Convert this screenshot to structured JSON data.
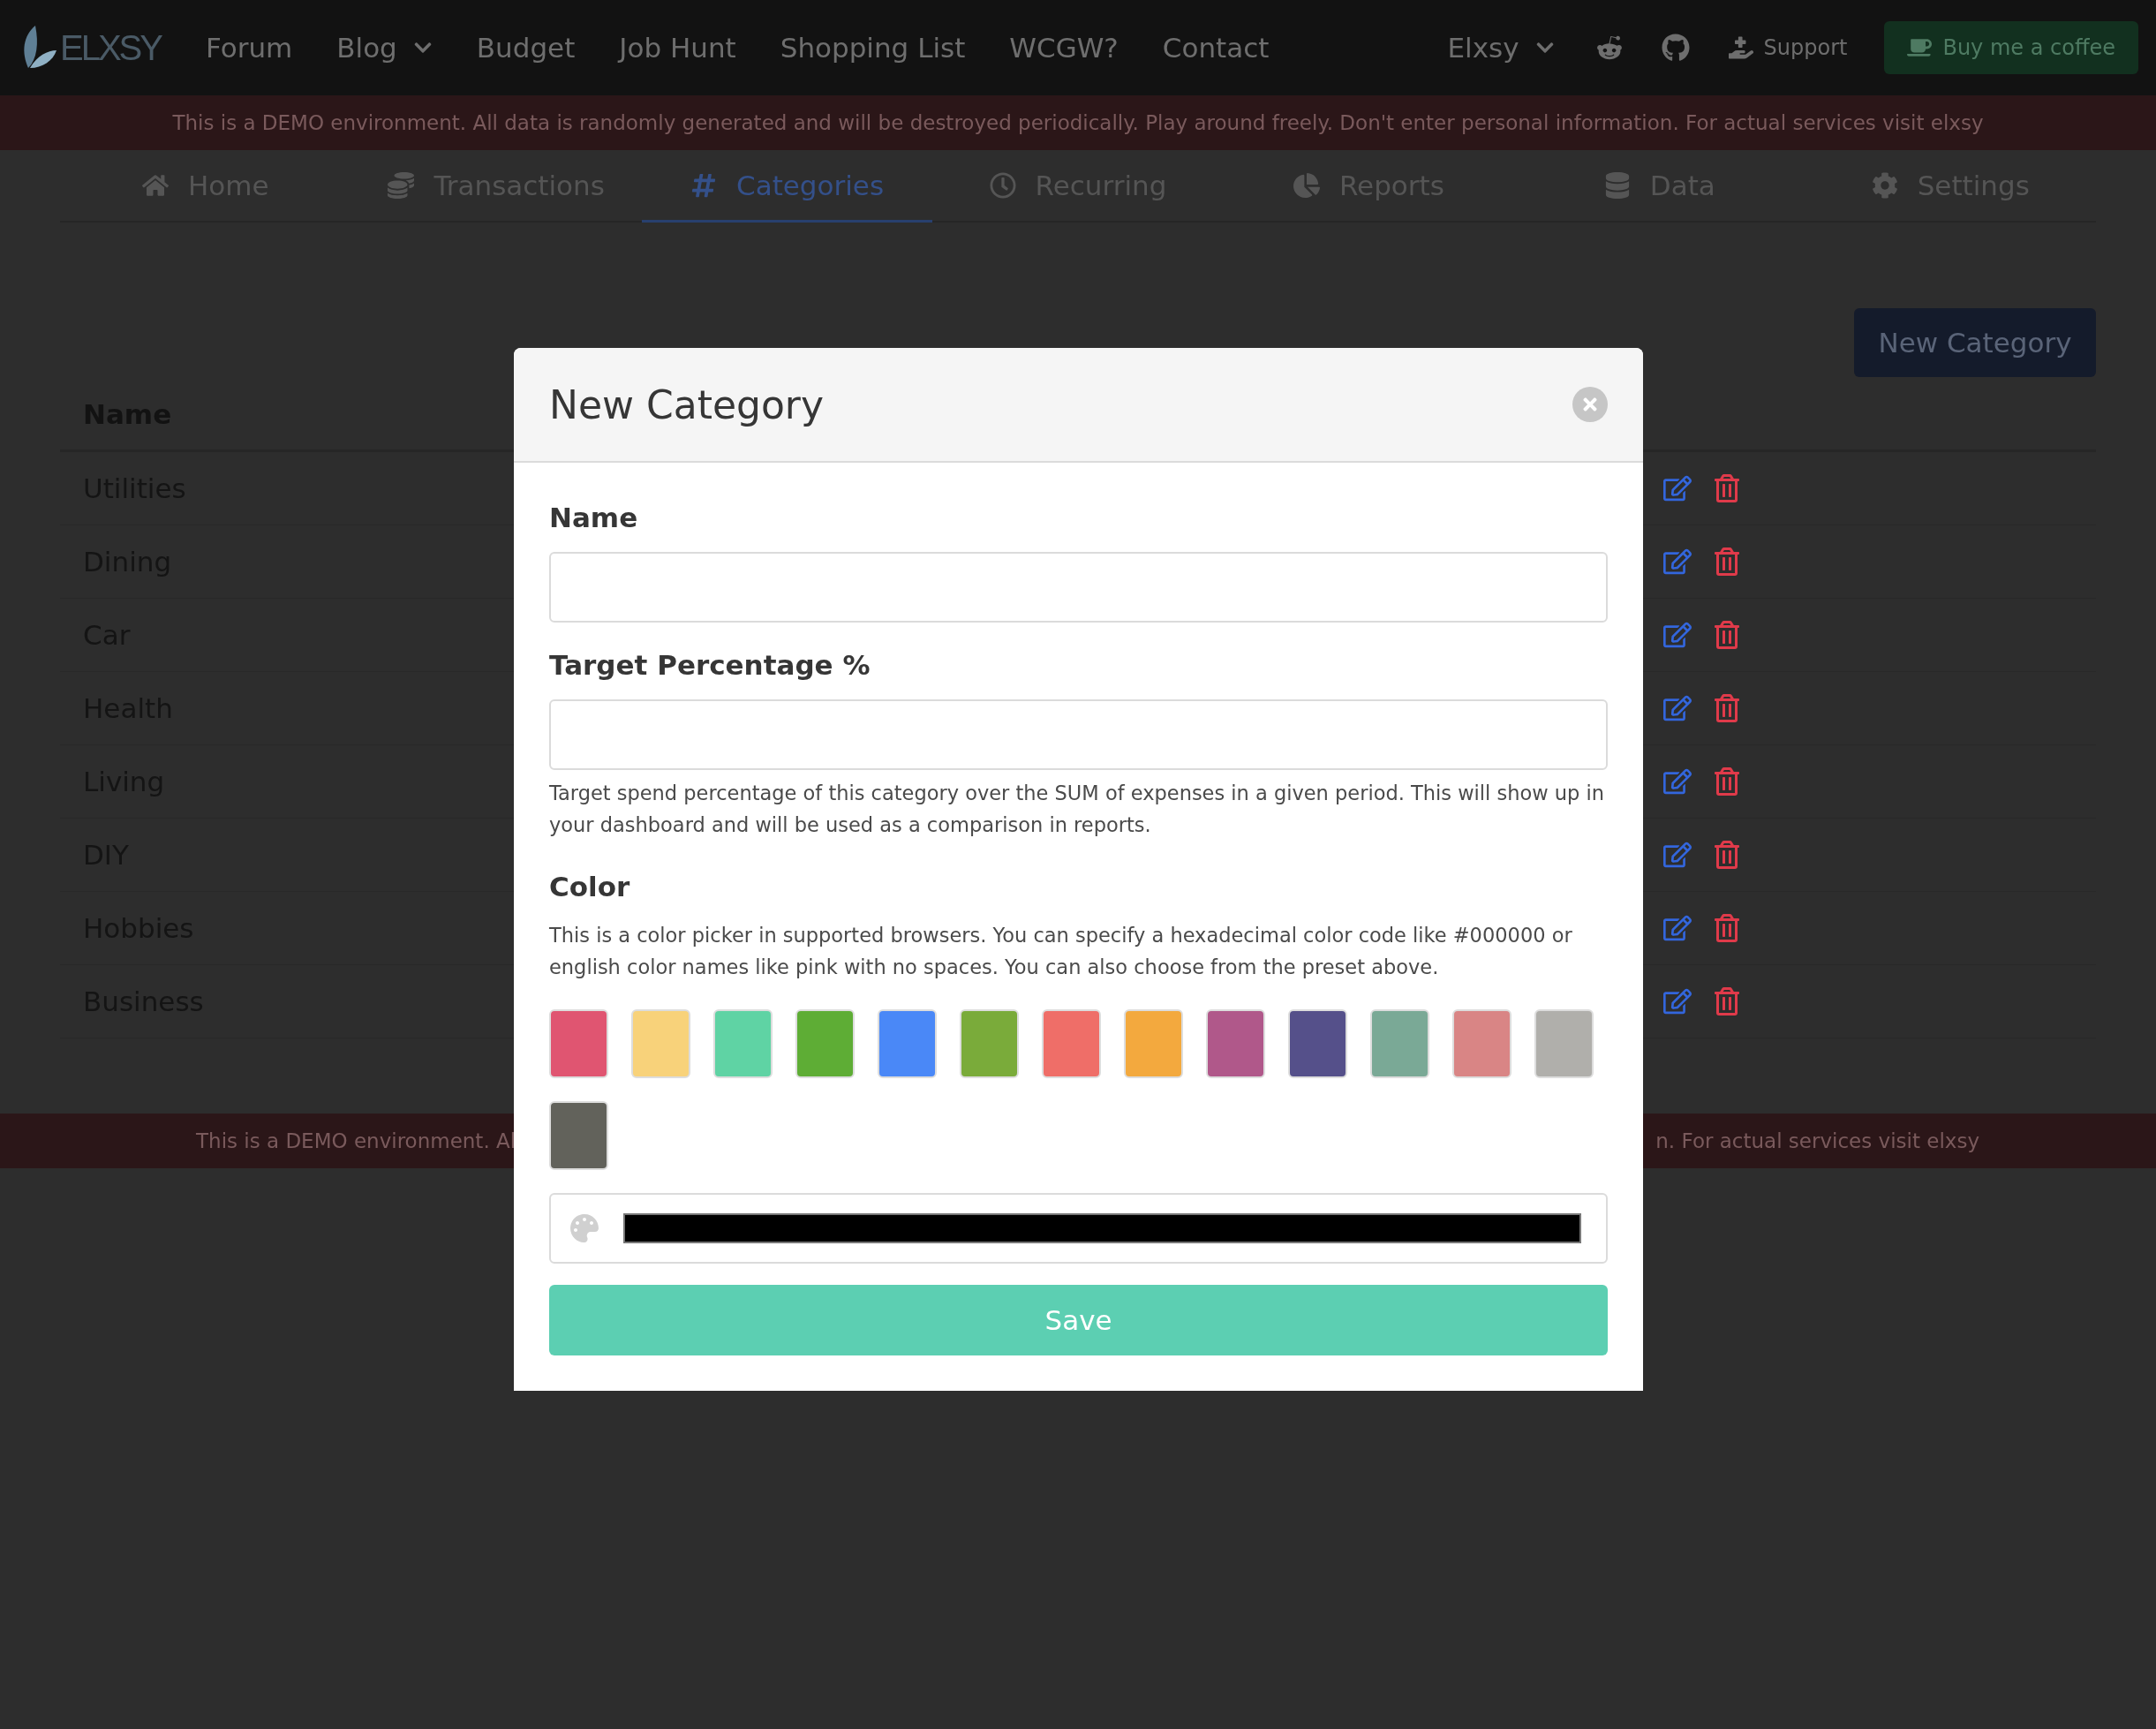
{
  "navbar": {
    "logo_text": "ELXSY",
    "items": [
      {
        "label": "Forum",
        "dropdown": false
      },
      {
        "label": "Blog",
        "dropdown": true
      },
      {
        "label": "Budget",
        "dropdown": false
      },
      {
        "label": "Job Hunt",
        "dropdown": false
      },
      {
        "label": "Shopping List",
        "dropdown": false
      },
      {
        "label": "WCGW?",
        "dropdown": false
      },
      {
        "label": "Contact",
        "dropdown": false
      }
    ],
    "user_menu": "Elxsy",
    "support": "Support",
    "coffee_button": "Buy me a coffee"
  },
  "demo_banner": "This is a DEMO environment. All data is randomly generated and will be destroyed periodically. Play around freely. Don't enter personal information. For actual services visit elxsy",
  "tabs": [
    {
      "label": "Home",
      "selected": false
    },
    {
      "label": "Transactions",
      "selected": false
    },
    {
      "label": "Categories",
      "selected": true
    },
    {
      "label": "Recurring",
      "selected": false
    },
    {
      "label": "Reports",
      "selected": false
    },
    {
      "label": "Data",
      "selected": false
    },
    {
      "label": "Settings",
      "selected": false
    }
  ],
  "new_category_button": "New Category",
  "table": {
    "columns": [
      "Name"
    ],
    "rows": [
      "Utilities",
      "Dining",
      "Car",
      "Health",
      "Living",
      "DIY",
      "Hobbies",
      "Business"
    ]
  },
  "footer_banner": [
    "This is a DEMO environment. Al",
    "n. For actual services visit elxsy"
  ],
  "modal": {
    "title": "New Category",
    "name_label": "Name",
    "target_label": "Target Percentage %",
    "target_help": "Target spend percentage of this category over the SUM of expenses in a given period. This will show up in your dashboard and will be used as a comparison in reports.",
    "color_label": "Color",
    "color_help": "This is a color picker in supported browsers. You can specify a hexadecimal color code like #000000 or english color names like pink with no spaces. You can also choose from the preset above.",
    "swatches": [
      {
        "color": "#e05571"
      },
      {
        "color": "#f8d27a"
      },
      {
        "color": "#5fd3a4"
      },
      {
        "color": "#5ead35"
      },
      {
        "color": "#4a88f7"
      },
      {
        "color": "#7aab3a"
      },
      {
        "color": "#ef6e68"
      },
      {
        "color": "#f3a93e"
      },
      {
        "color": "#b0588a"
      },
      {
        "color": "#55508a"
      },
      {
        "color": "#7aa996"
      },
      {
        "color": "#d98585"
      },
      {
        "color": "#b0afab"
      },
      {
        "color": "#62625b"
      }
    ],
    "save_button": "Save"
  }
}
